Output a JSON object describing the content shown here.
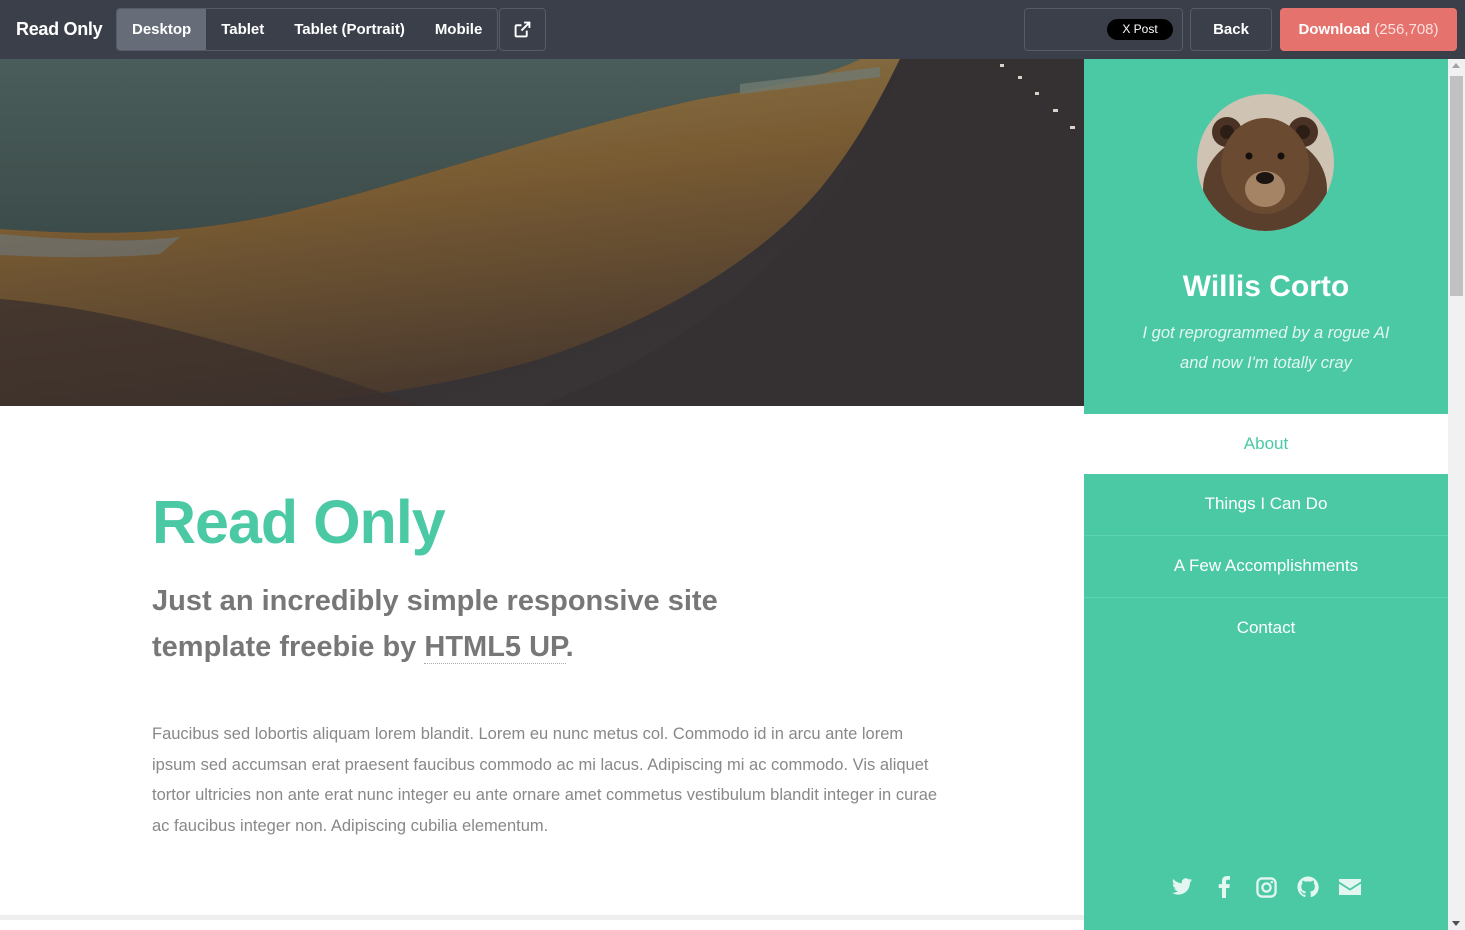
{
  "topbar": {
    "brand": "Read Only",
    "views": [
      {
        "label": "Desktop",
        "active": true
      },
      {
        "label": "Tablet",
        "active": false
      },
      {
        "label": "Tablet (Portrait)",
        "active": false
      },
      {
        "label": "Mobile",
        "active": false
      }
    ],
    "external_icon": "external-link-icon",
    "x_post_label": "X Post",
    "back_label": "Back",
    "download_label": "Download",
    "download_count": "(256,708)",
    "download_color": "#e5726d"
  },
  "main": {
    "title": "Read Only",
    "subtitle_before": "Just an incredibly simple responsive site template freebie by ",
    "subtitle_link": "HTML5 UP",
    "subtitle_after": ".",
    "body": "Faucibus sed lobortis aliquam lorem blandit. Lorem eu nunc metus col. Commodo id in arcu ante lorem ipsum sed accumsan erat praesent faucibus commodo ac mi lacus. Adipiscing mi ac commodo. Vis aliquet tortor ultricies non ante erat nunc integer eu ante ornare amet commetus vestibulum blandit integer in curae ac faucibus integer non. Adipiscing cubilia elementum."
  },
  "sidebar": {
    "accent_color": "#4bc9a4",
    "name": "Willis Corto",
    "tagline_line1": "I got reprogrammed by a rogue AI",
    "tagline_line2": "and now I'm totally cray",
    "nav": [
      {
        "label": "About",
        "active": true
      },
      {
        "label": "Things I Can Do",
        "active": false
      },
      {
        "label": "A Few Accomplishments",
        "active": false
      },
      {
        "label": "Contact",
        "active": false
      }
    ],
    "socials": [
      "twitter-icon",
      "facebook-icon",
      "instagram-icon",
      "github-icon",
      "envelope-icon"
    ]
  }
}
